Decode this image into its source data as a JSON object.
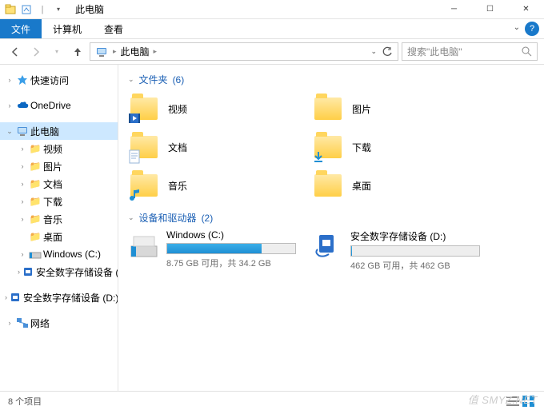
{
  "window": {
    "title": "此电脑"
  },
  "ribbon": {
    "file": "文件",
    "tabs": [
      "计算机",
      "查看"
    ]
  },
  "address": {
    "location": "此电脑",
    "search_placeholder": "搜索\"此电脑\""
  },
  "nav": {
    "quick_access": "快速访问",
    "onedrive": "OneDrive",
    "this_pc": "此电脑",
    "children": [
      {
        "label": "视频"
      },
      {
        "label": "图片"
      },
      {
        "label": "文档"
      },
      {
        "label": "下载"
      },
      {
        "label": "音乐"
      },
      {
        "label": "桌面"
      },
      {
        "label": "Windows (C:)"
      },
      {
        "label": "安全数字存储设备 ("
      }
    ],
    "secure_drive_full": "安全数字存储设备 (D:)",
    "network": "网络"
  },
  "groups": {
    "folders": {
      "title": "文件夹",
      "count": "(6)"
    },
    "drives": {
      "title": "设备和驱动器",
      "count": "(2)"
    }
  },
  "folders": [
    {
      "label": "视频",
      "key": "video"
    },
    {
      "label": "图片",
      "key": "pictures"
    },
    {
      "label": "文档",
      "key": "documents"
    },
    {
      "label": "下载",
      "key": "downloads"
    },
    {
      "label": "音乐",
      "key": "music"
    },
    {
      "label": "桌面",
      "key": "desktop"
    }
  ],
  "drives": [
    {
      "name": "Windows (C:)",
      "status": "8.75 GB 可用，共 34.2 GB",
      "fill_pct": 74
    },
    {
      "name": "安全数字存储设备 (D:)",
      "status": "462 GB 可用，共 462 GB",
      "fill_pct": 0.5
    }
  ],
  "status": {
    "items": "8 个项目"
  },
  "watermark": "值 SMYZ.NET"
}
